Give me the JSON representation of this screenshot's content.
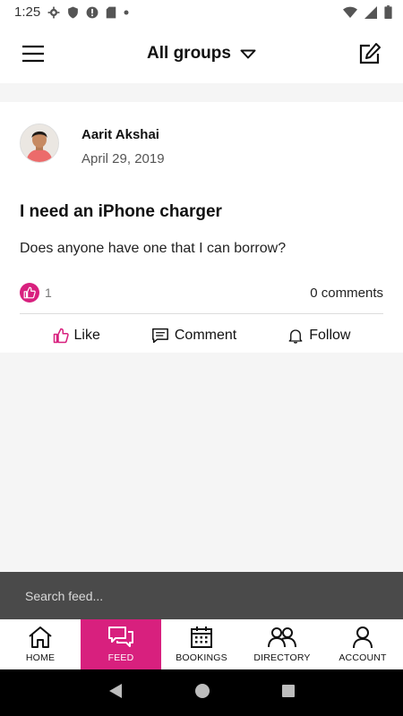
{
  "status_bar": {
    "time": "1:25",
    "icons": [
      "settings-icon",
      "shield-icon",
      "alert-icon",
      "sd-card-icon",
      "dot-icon",
      "wifi-icon",
      "signal-icon",
      "battery-icon"
    ]
  },
  "header": {
    "title": "All groups",
    "menu_icon": "hamburger-icon",
    "dropdown_icon": "triangle-down-icon",
    "compose_icon": "compose-icon"
  },
  "post": {
    "author": "Aarit Akshai",
    "date": "April 29, 2019",
    "title": "I need an iPhone charger",
    "body": "Does anyone have one that I can borrow?",
    "like_count": "1",
    "comments": "0 comments",
    "actions": {
      "like": "Like",
      "comment": "Comment",
      "follow": "Follow"
    }
  },
  "search": {
    "placeholder": "Search feed..."
  },
  "bottom_nav": {
    "items": [
      {
        "label": "HOME",
        "icon": "home-icon"
      },
      {
        "label": "FEED",
        "icon": "chat-icon",
        "active": true
      },
      {
        "label": "BOOKINGS",
        "icon": "calendar-icon"
      },
      {
        "label": "DIRECTORY",
        "icon": "people-icon"
      },
      {
        "label": "ACCOUNT",
        "icon": "person-icon"
      }
    ]
  },
  "colors": {
    "accent": "#d8207e",
    "search_bg": "#4a4a4a",
    "page_bg": "#f5f5f5"
  }
}
